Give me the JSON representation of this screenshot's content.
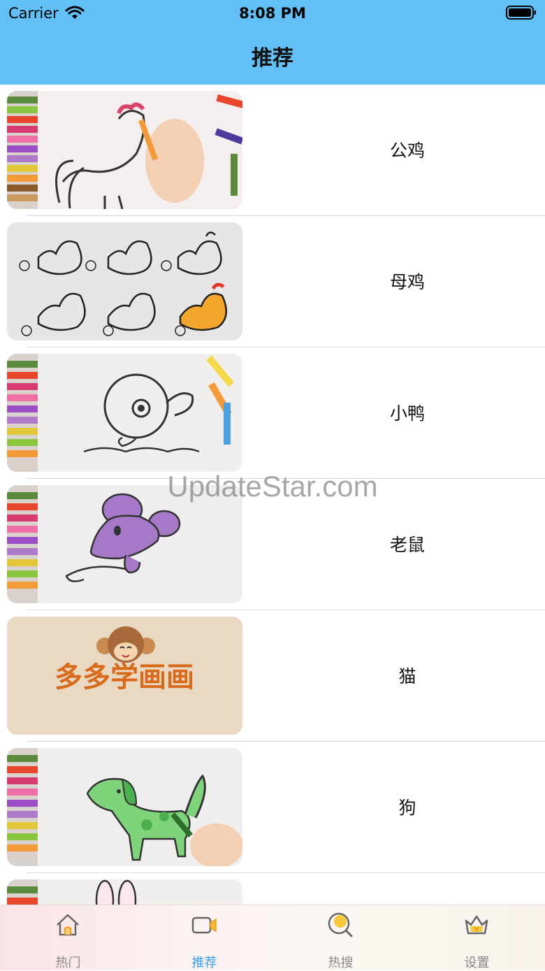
{
  "status_bar": {
    "carrier": "Carrier",
    "time": "8:08 PM"
  },
  "nav": {
    "title": "推荐"
  },
  "list": {
    "items": [
      {
        "label": "公鸡"
      },
      {
        "label": "母鸡"
      },
      {
        "label": "小鸭"
      },
      {
        "label": "老鼠"
      },
      {
        "label": "猫",
        "thumb_text": "多多学画画"
      },
      {
        "label": "狗"
      },
      {
        "label": ""
      }
    ]
  },
  "watermark": "UpdateStar.com",
  "tabbar": {
    "tabs": [
      {
        "label": "热门",
        "icon": "house-icon"
      },
      {
        "label": "推荐",
        "icon": "video-camera-icon",
        "active": true
      },
      {
        "label": "热搜",
        "icon": "search-icon"
      },
      {
        "label": "设置",
        "icon": "crown-icon"
      }
    ]
  },
  "colors": {
    "header": "#62c0f7",
    "active_tab": "#3aa0ea",
    "inactive_tab": "#888888"
  }
}
